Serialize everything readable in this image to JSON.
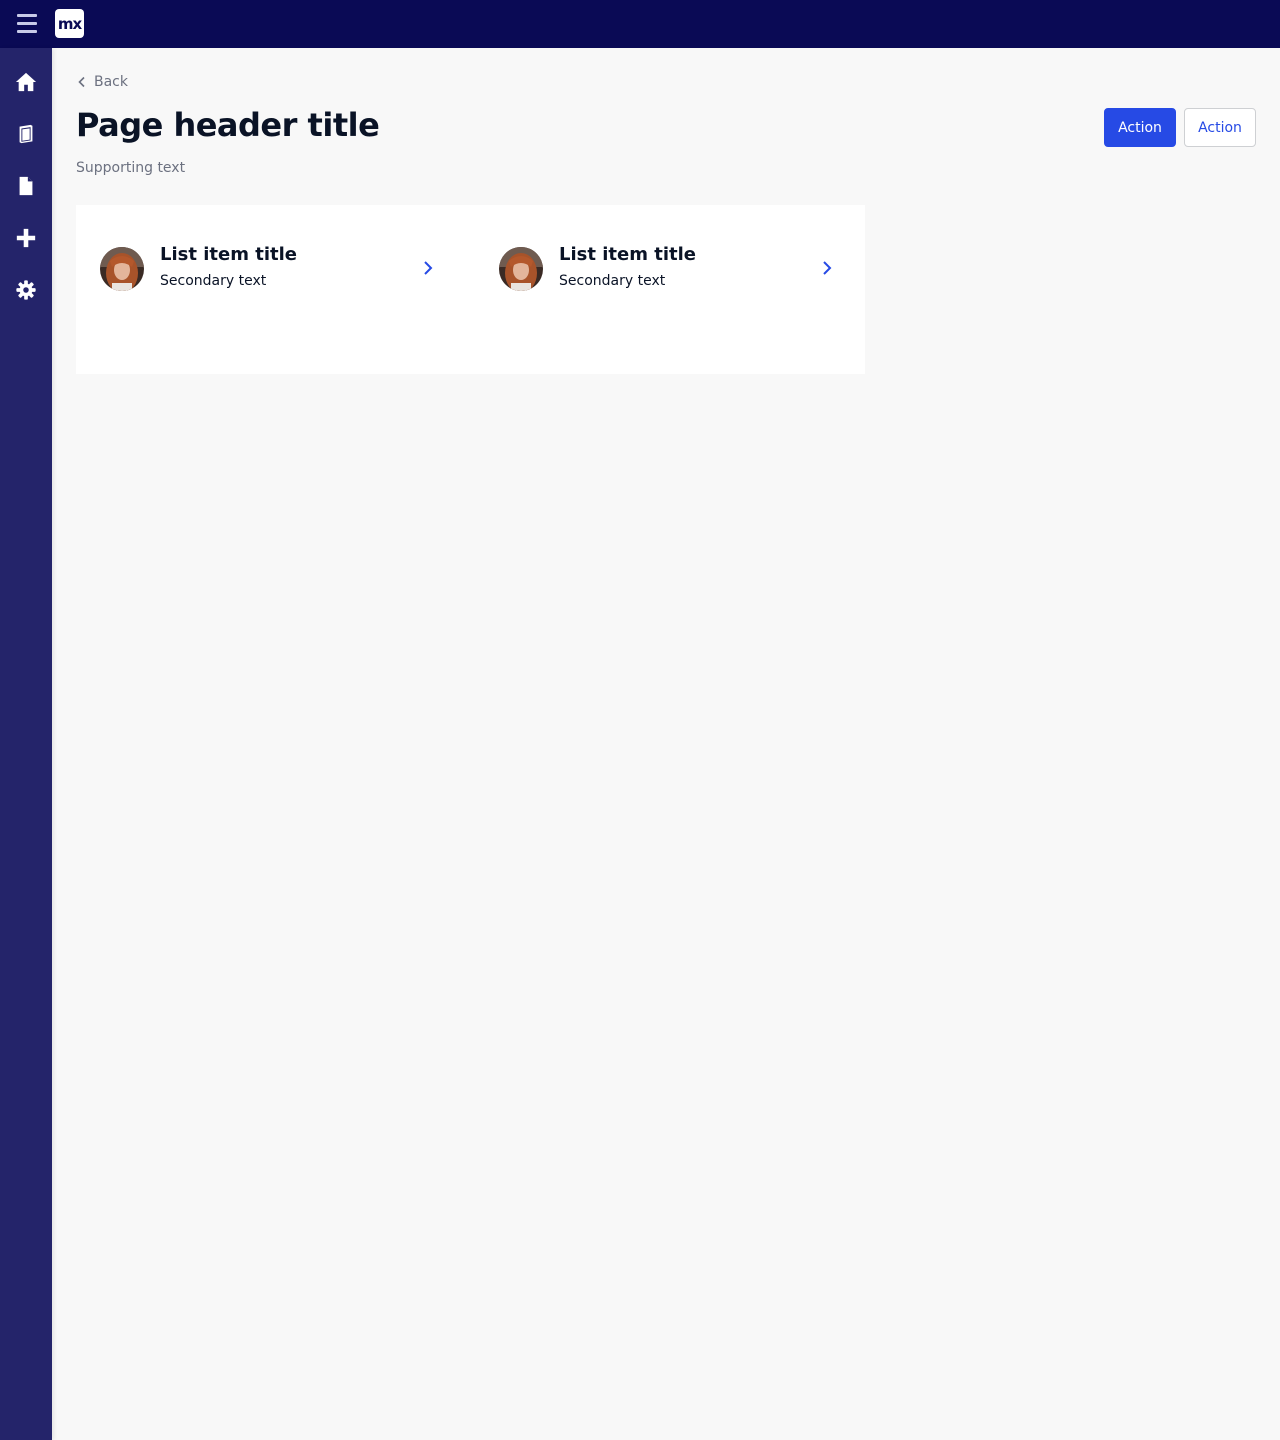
{
  "topbar": {
    "logo_text": "mx",
    "menu_icon": "hamburger-icon",
    "background": "#0a0a55"
  },
  "sidebar": {
    "background": "#24246a",
    "items": [
      {
        "name": "home",
        "icon": "home-icon"
      },
      {
        "name": "book",
        "icon": "book-icon"
      },
      {
        "name": "document",
        "icon": "file-icon"
      },
      {
        "name": "add",
        "icon": "plus-icon"
      },
      {
        "name": "settings",
        "icon": "gear-icon"
      }
    ]
  },
  "page": {
    "back_label": "Back",
    "title": "Page header title",
    "supporting_text": "Supporting text",
    "primary_action_label": "Action",
    "secondary_action_label": "Action"
  },
  "list": {
    "items": [
      {
        "title": "List item title",
        "secondary": "Secondary text",
        "icon": "chevron-right-icon"
      },
      {
        "title": "List item title",
        "secondary": "Secondary text",
        "icon": "chevron-right-icon"
      }
    ]
  },
  "colors": {
    "accent": "#264ae5",
    "text": "#0a1326",
    "muted": "#6c7180",
    "page_bg": "#f8f8f8"
  }
}
